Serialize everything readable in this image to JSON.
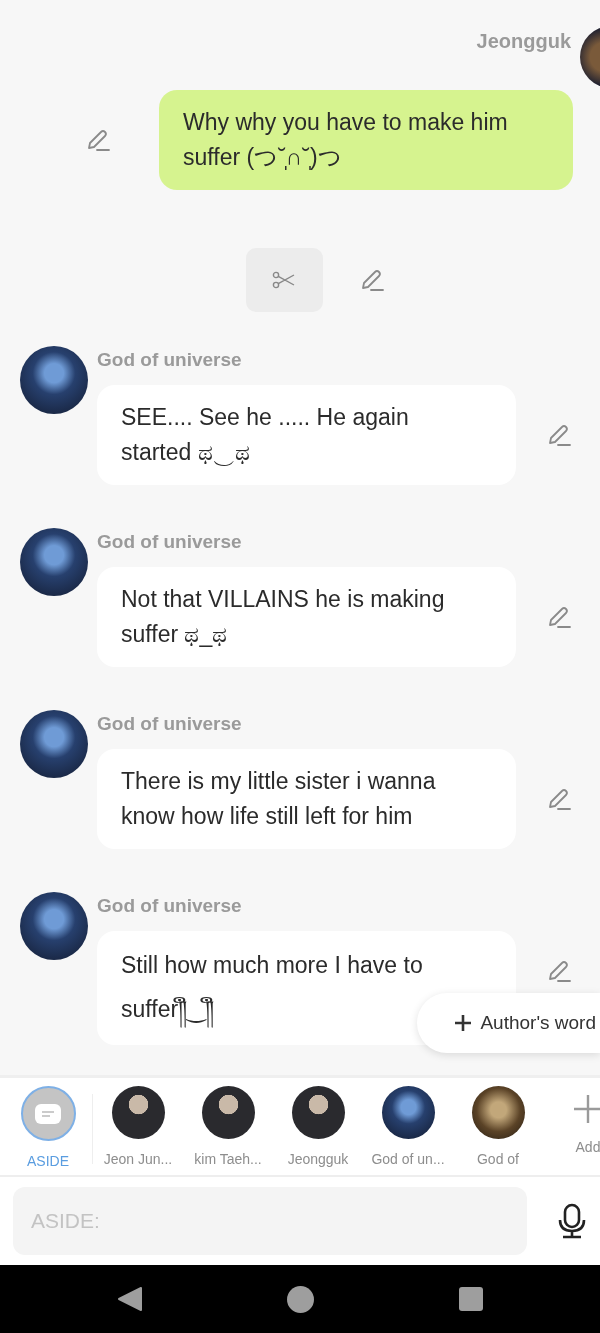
{
  "messages": [
    {
      "kind": "sent",
      "sender": "Jeongguk",
      "text": "Why why you have to make him suffer (つ˘̩∩˘̩)つ"
    },
    {
      "kind": "scene-break"
    },
    {
      "kind": "received",
      "sender": "God of universe",
      "text": "SEE.... See he ..... He again started ಥ‿ಥ"
    },
    {
      "kind": "received",
      "sender": "God of universe",
      "text": "Not that VILLAINS he is making suffer  ಥ_ಥ"
    },
    {
      "kind": "received",
      "sender": "God of universe",
      "text": "There is my little sister i wanna know how life still left for him"
    },
    {
      "kind": "received",
      "sender": "God of universe",
      "text": "Still how much more I have to suffer༎ຶ‿༎ຶ"
    }
  ],
  "authors_word_button": {
    "label": "Author's word"
  },
  "characters": [
    {
      "kind": "aside",
      "name": "ASIDE",
      "selected": true
    },
    {
      "kind": "person",
      "name": "Jeon Jun...",
      "selected": false
    },
    {
      "kind": "person",
      "name": "kim Taeh...",
      "selected": false
    },
    {
      "kind": "person",
      "name": "Jeongguk",
      "selected": false
    },
    {
      "kind": "cosmic",
      "name": "God of un...",
      "selected": false
    },
    {
      "kind": "golden",
      "name": "God of",
      "selected": false
    },
    {
      "kind": "add",
      "name": "Add",
      "selected": false
    }
  ],
  "input": {
    "placeholder": "ASIDE:"
  }
}
